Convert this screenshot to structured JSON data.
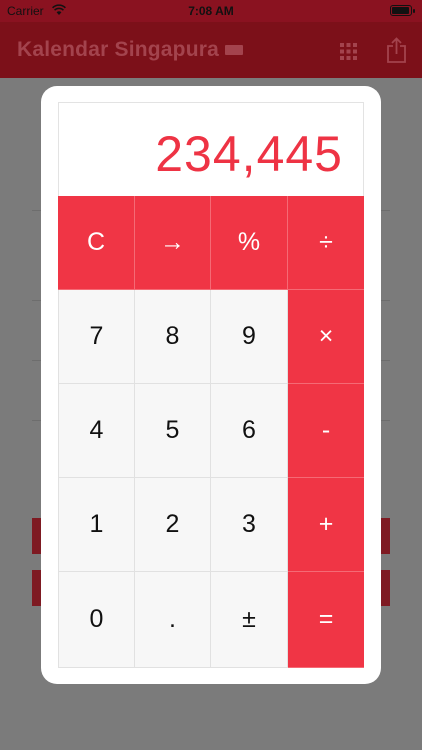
{
  "status_bar": {
    "carrier": "Carrier",
    "time": "7:08 AM",
    "battery_level": 1.0
  },
  "navbar": {
    "title": "Kalendar Singapura"
  },
  "calculator": {
    "display": "234,445",
    "accent_color": "#f03545",
    "keys": [
      {
        "label": "C",
        "name": "clear-key",
        "style": "red"
      },
      {
        "label": "→",
        "name": "backspace-key",
        "style": "red"
      },
      {
        "label": "%",
        "name": "percent-key",
        "style": "red"
      },
      {
        "label": "÷",
        "name": "divide-key",
        "style": "red"
      },
      {
        "label": "7",
        "name": "digit-7-key",
        "style": "light"
      },
      {
        "label": "8",
        "name": "digit-8-key",
        "style": "light"
      },
      {
        "label": "9",
        "name": "digit-9-key",
        "style": "light"
      },
      {
        "label": "×",
        "name": "multiply-key",
        "style": "red"
      },
      {
        "label": "4",
        "name": "digit-4-key",
        "style": "light"
      },
      {
        "label": "5",
        "name": "digit-5-key",
        "style": "light"
      },
      {
        "label": "6",
        "name": "digit-6-key",
        "style": "light"
      },
      {
        "label": "-",
        "name": "subtract-key",
        "style": "red"
      },
      {
        "label": "1",
        "name": "digit-1-key",
        "style": "light"
      },
      {
        "label": "2",
        "name": "digit-2-key",
        "style": "light"
      },
      {
        "label": "3",
        "name": "digit-3-key",
        "style": "light"
      },
      {
        "label": "+",
        "name": "add-key",
        "style": "red"
      },
      {
        "label": "0",
        "name": "digit-0-key",
        "style": "light"
      },
      {
        "label": ".",
        "name": "decimal-key",
        "style": "light"
      },
      {
        "label": "±",
        "name": "sign-toggle-key",
        "style": "light"
      },
      {
        "label": "=",
        "name": "equals-key",
        "style": "red"
      }
    ]
  }
}
